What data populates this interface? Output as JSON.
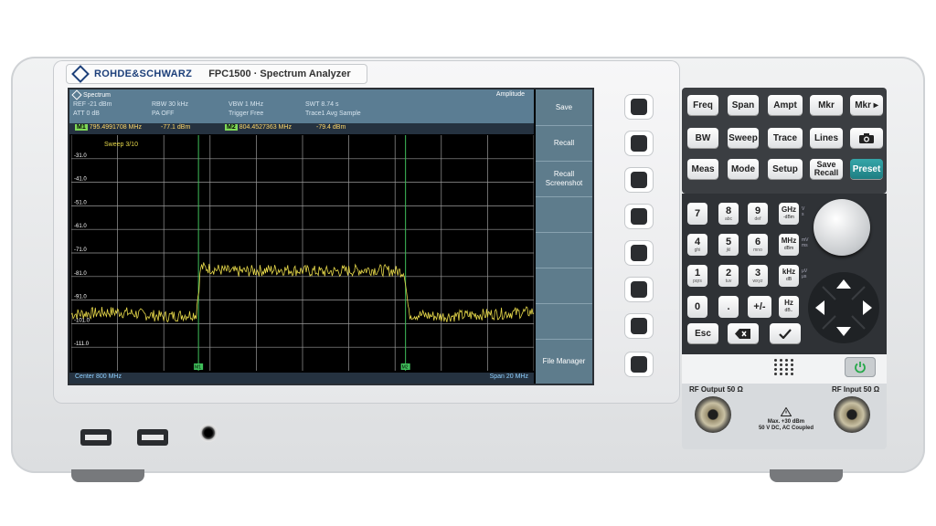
{
  "brand": {
    "name": "ROHDE&SCHWARZ",
    "model": "FPC1500 · Spectrum Analyzer"
  },
  "screen": {
    "mode": "Spectrum",
    "amplitude_tab": "Amplitude",
    "settings_row1": [
      "REF -21 dBm",
      "RBW 30 kHz",
      "VBW 1 MHz",
      "SWT 8.74 s"
    ],
    "settings_row2": [
      "ATT 0 dB",
      "PA OFF",
      "Trigger Free",
      "Trace1 Avg Sample"
    ],
    "markers": [
      {
        "id": "M1",
        "freq": "795.4991708 MHz",
        "level": "-77.1 dBm"
      },
      {
        "id": "M2",
        "freq": "804.4527363 MHz",
        "level": "-79.4 dBm"
      }
    ],
    "sweep": "Sweep 3/10",
    "center": "Center 800 MHz",
    "span": "Span 20 MHz",
    "softkeys": [
      "Save",
      "Recall",
      "Recall\nScreenshot",
      "",
      "",
      "",
      "",
      "File Manager"
    ]
  },
  "chart_data": {
    "type": "line",
    "x_unit": "MHz",
    "xlim": [
      790,
      810
    ],
    "ylim": [
      -121,
      -21
    ],
    "y_tick_labels": [
      "-31.0",
      "-41.0",
      "-51.0",
      "-61.0",
      "-71.0",
      "-81.0",
      "-91.0",
      "-101.0",
      "-111.0"
    ],
    "series": [
      {
        "x": [
          790,
          792,
          794,
          795.4,
          795.6,
          797,
          799,
          801,
          803,
          804.4,
          804.6,
          806,
          808,
          810
        ],
        "y": [
          -97,
          -96,
          -98,
          -97,
          -77,
          -79,
          -78,
          -79,
          -78,
          -79,
          -97,
          -98,
          -97,
          -96
        ]
      }
    ],
    "marker_x": [
      795.4991708,
      804.4527363
    ],
    "marker_labels": [
      "M1",
      "M2"
    ],
    "trace_color": "#e6d84a",
    "grid": true
  },
  "keys": {
    "row1": [
      "Freq",
      "Span",
      "Ampt",
      "Mkr",
      "Mkr ▸"
    ],
    "row2": [
      "BW",
      "Sweep",
      "Trace",
      "Lines",
      "camera"
    ],
    "row3": [
      "Meas",
      "Mode",
      "Setup",
      "Save Recall",
      "Preset"
    ],
    "numbers": [
      {
        "d": "7",
        "s": ""
      },
      {
        "d": "8",
        "s": "abc"
      },
      {
        "d": "9",
        "s": "def"
      },
      {
        "d": "4",
        "s": "ghi"
      },
      {
        "d": "5",
        "s": "jkl"
      },
      {
        "d": "6",
        "s": "mno"
      },
      {
        "d": "1",
        "s": "pqrs"
      },
      {
        "d": "2",
        "s": "tuv"
      },
      {
        "d": "3",
        "s": "wxyz"
      },
      {
        "d": "0",
        "s": ""
      },
      {
        "d": ".",
        "s": ""
      },
      {
        "d": "+/-",
        "s": ""
      }
    ],
    "units": [
      {
        "u": "GHz",
        "s": "-dBm",
        "side": "V\ns"
      },
      {
        "u": "MHz",
        "s": "dBm",
        "side": "mV\nms"
      },
      {
        "u": "kHz",
        "s": "dB",
        "side": "μV\nμs"
      },
      {
        "u": "Hz",
        "s": "dB..",
        "side": ""
      }
    ],
    "esc": "Esc"
  },
  "rf": {
    "output_label": "RF Output 50 Ω",
    "input_label": "RF Input 50 Ω",
    "warning": "Max. +30 dBm\n50 V DC, AC Coupled"
  },
  "colors": {
    "header": "#5b7d93",
    "softkeys": "#5e7c8c",
    "trace": "#e6d84a",
    "grid": "#9a9a9a",
    "preset": "#2a9397"
  }
}
